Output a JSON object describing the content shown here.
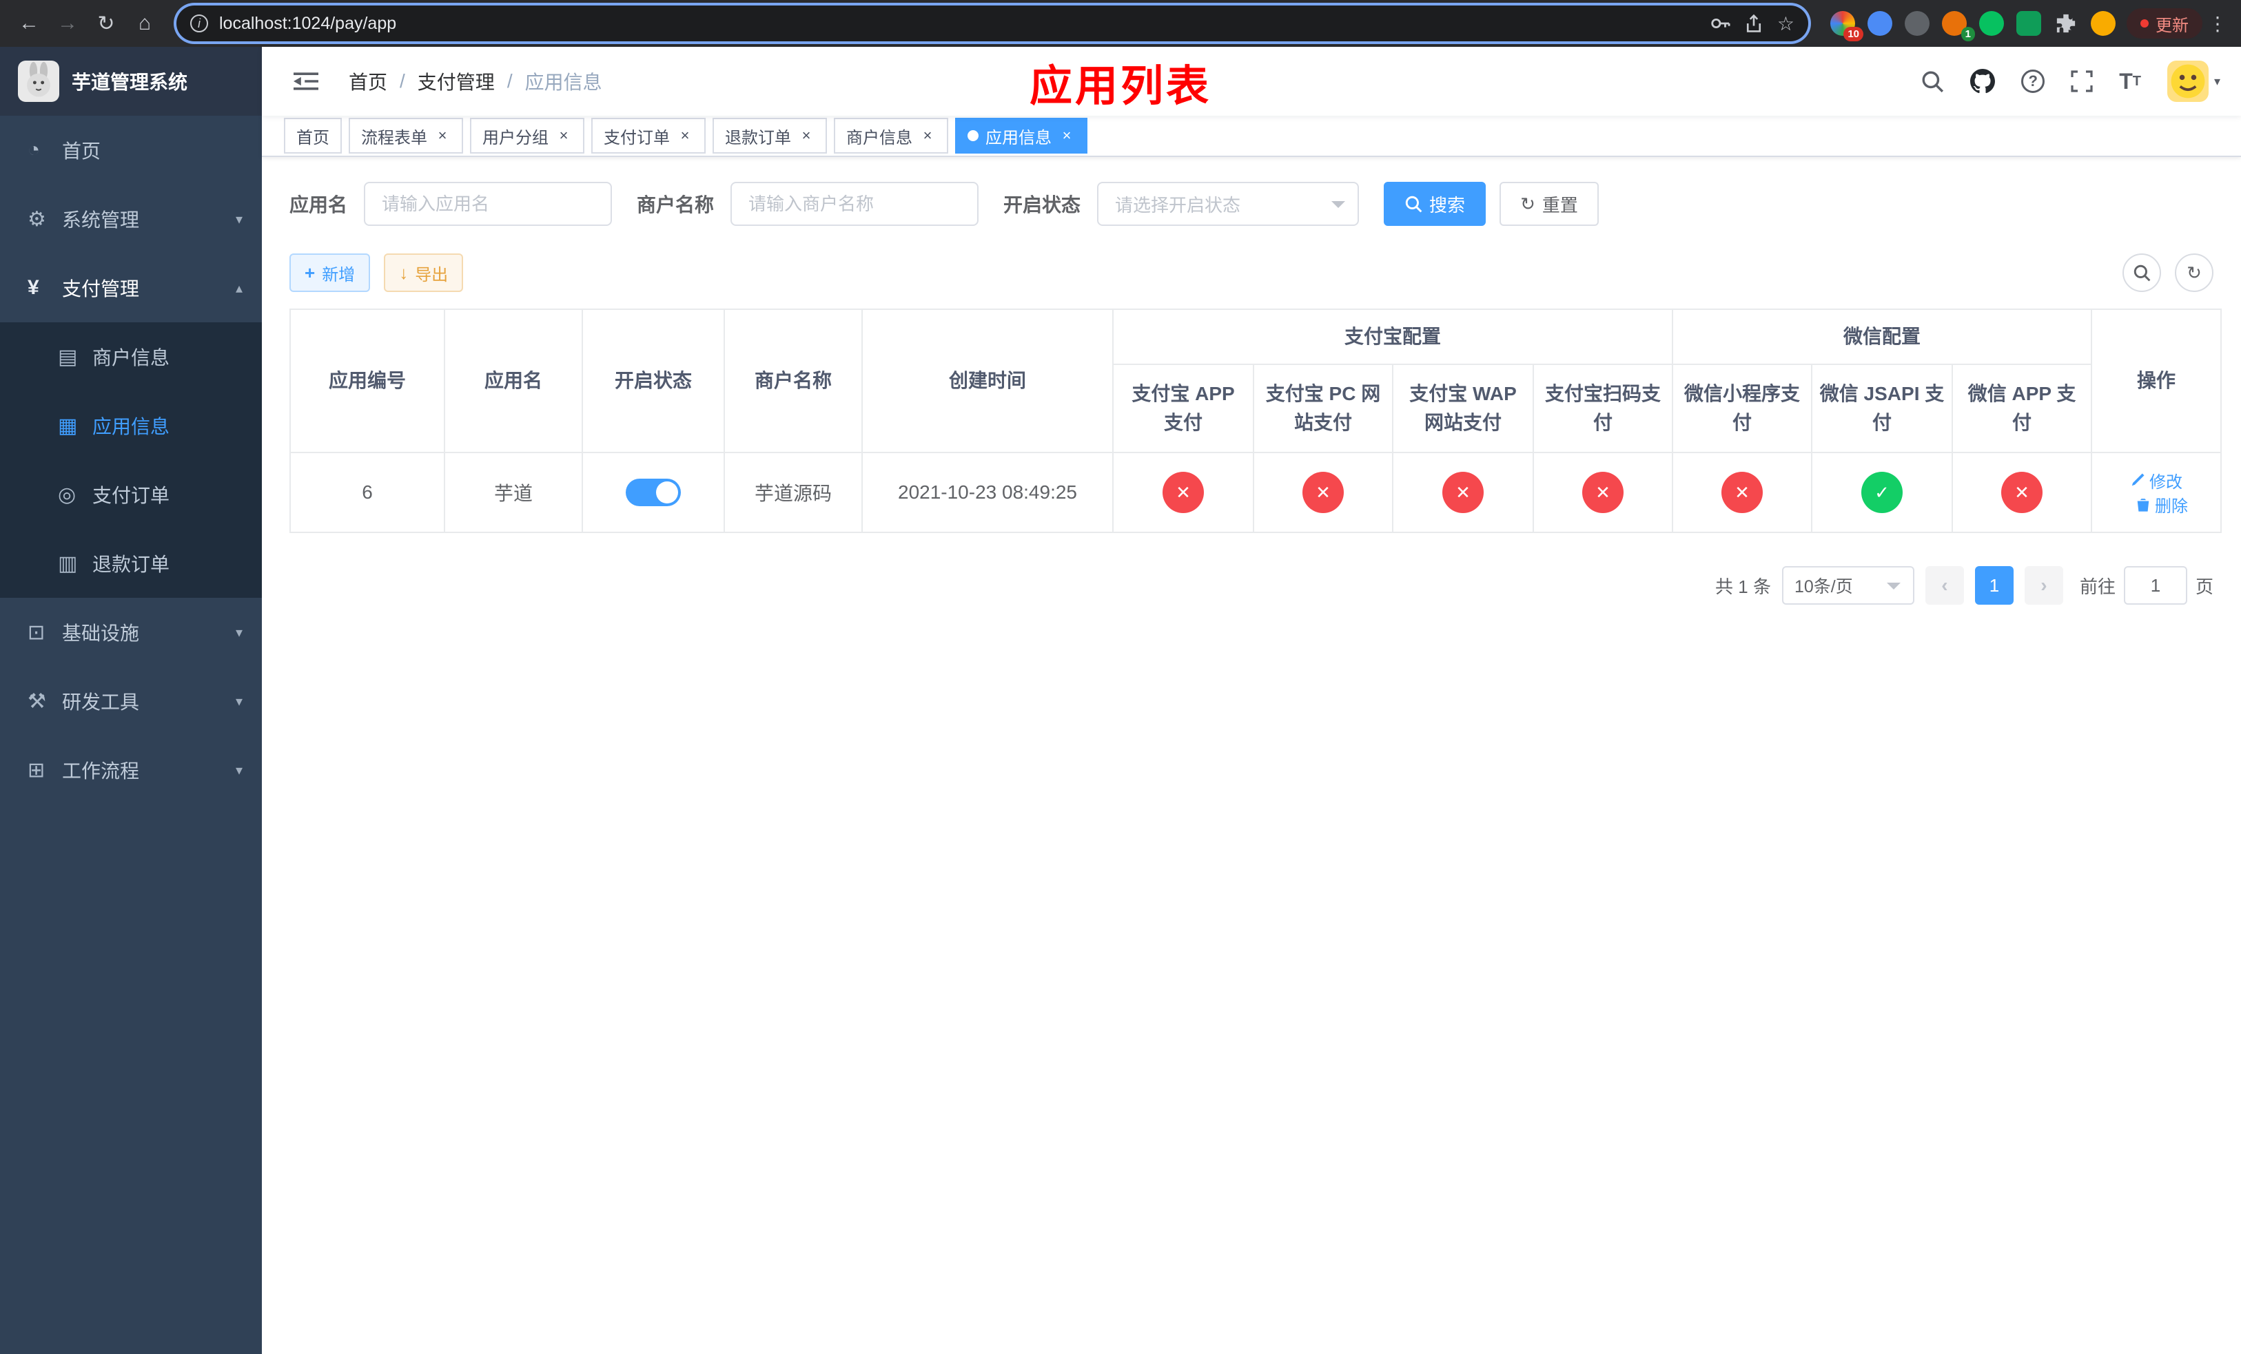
{
  "colors": {
    "primary": "#409eff",
    "success": "#13ce66",
    "danger": "#f5484d",
    "warning": "#e6a23c",
    "title_red": "#ff0000",
    "sidebar_bg": "#304156",
    "submenu_bg": "#1f2d3d"
  },
  "browser": {
    "url": "localhost:1024/pay/app",
    "update_label": "更新",
    "ext_badge_red": "10",
    "ext_badge_green": "1",
    "icons": {
      "back": "←",
      "forward": "→",
      "reload": "↻",
      "home": "⌂",
      "bookmark": "☆",
      "kebab": "⋮"
    }
  },
  "sidebar": {
    "title": "芋道管理系统",
    "menu": [
      {
        "label": "首页",
        "glyph": "◔",
        "arrow": ""
      },
      {
        "label": "系统管理",
        "glyph": "⚙",
        "arrow": "▾"
      },
      {
        "label": "支付管理",
        "glyph": "¥",
        "arrow": "▴"
      },
      {
        "label": "商户信息",
        "glyph": "▤",
        "arrow": ""
      },
      {
        "label": "应用信息",
        "glyph": "▦",
        "arrow": ""
      },
      {
        "label": "支付订单",
        "glyph": "◎",
        "arrow": ""
      },
      {
        "label": "退款订单",
        "glyph": "▥",
        "arrow": ""
      },
      {
        "label": "基础设施",
        "glyph": "⊡",
        "arrow": "▾"
      },
      {
        "label": "研发工具",
        "glyph": "⚒",
        "arrow": "▾"
      },
      {
        "label": "工作流程",
        "glyph": "⊞",
        "arrow": "▾"
      }
    ]
  },
  "header": {
    "breadcrumb": [
      "首页",
      "支付管理",
      "应用信息"
    ],
    "separator": "/",
    "page_title": "应用列表"
  },
  "tabs": [
    {
      "label": "首页",
      "closable": false,
      "active": false
    },
    {
      "label": "流程表单",
      "closable": true,
      "active": false
    },
    {
      "label": "用户分组",
      "closable": true,
      "active": false
    },
    {
      "label": "支付订单",
      "closable": true,
      "active": false
    },
    {
      "label": "退款订单",
      "closable": true,
      "active": false
    },
    {
      "label": "商户信息",
      "closable": true,
      "active": false
    },
    {
      "label": "应用信息",
      "closable": true,
      "active": true
    }
  ],
  "filters": {
    "app_name_label": "应用名",
    "app_name_placeholder": "请输入应用名",
    "app_name_value": "",
    "merchant_label": "商户名称",
    "merchant_placeholder": "请输入商户名称",
    "merchant_value": "",
    "status_label": "开启状态",
    "status_placeholder": "请选择开启状态",
    "search_label": "搜索",
    "reset_label": "重置"
  },
  "toolbar": {
    "add_label": "新增",
    "export_label": "导出"
  },
  "table": {
    "headers": {
      "app_id": "应用编号",
      "app_name": "应用名",
      "status": "开启状态",
      "merchant": "商户名称",
      "created": "创建时间",
      "alipay_group": "支付宝配置",
      "wechat_group": "微信配置",
      "alipay_app": "支付宝 APP 支付",
      "alipay_pc": "支付宝 PC 网站支付",
      "alipay_wap": "支付宝 WAP 网站支付",
      "alipay_qr": "支付宝扫码支付",
      "wechat_lite": "微信小程序支付",
      "wechat_jsapi": "微信 JSAPI 支付",
      "wechat_app": "微信 APP 支付",
      "actions": "操作"
    },
    "rows": [
      {
        "app_id": "6",
        "app_name": "芋道",
        "status_on": true,
        "merchant": "芋道源码",
        "created": "2021-10-23 08:49:25",
        "alipay_app": "no",
        "alipay_pc": "no",
        "alipay_wap": "no",
        "alipay_qr": "no",
        "wechat_lite": "no",
        "wechat_jsapi": "yes",
        "wechat_app": "no",
        "edit_label": "修改",
        "delete_label": "删除"
      }
    ]
  },
  "pagination": {
    "total_label": "共 1 条",
    "page_size": "10条/页",
    "current_page": "1",
    "goto_prefix": "前往",
    "goto_value": "1",
    "goto_suffix": "页"
  }
}
